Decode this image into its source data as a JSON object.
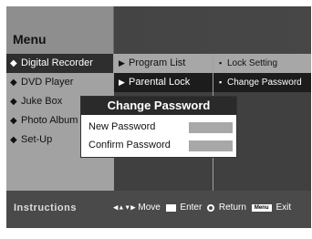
{
  "header": {
    "title": "Menu"
  },
  "main_menu": [
    {
      "label": "Digital Recorder",
      "bullet": "◆",
      "selected": true
    },
    {
      "label": "DVD Player",
      "bullet": "◆"
    },
    {
      "label": "Juke Box",
      "bullet": "◆"
    },
    {
      "label": "Photo Album",
      "bullet": "◆"
    },
    {
      "label": "Set-Up",
      "bullet": "◆"
    }
  ],
  "sub_menu": [
    {
      "label": "Program List",
      "bullet": "▶"
    },
    {
      "label": "Parental Lock",
      "bullet": "▶"
    }
  ],
  "sub_sub_menu": [
    {
      "label": "Lock Setting",
      "bullet": "▪"
    },
    {
      "label": "Change Password",
      "bullet": "▪"
    }
  ],
  "dialog": {
    "title": "Change Password",
    "fields": [
      {
        "label": "New Password",
        "value": ""
      },
      {
        "label": "Confirm Password",
        "value": ""
      }
    ]
  },
  "footer": {
    "instructions_label": "Instructions",
    "hints": {
      "move": "Move",
      "enter": "Enter",
      "return": "Return",
      "exit": "Exit",
      "menu_key": "Menu",
      "move_icon": "◀▲▼▶"
    }
  },
  "colors": {
    "header_left": "#8e8e8e",
    "header_right": "#444444",
    "selection": "#2e2e2e",
    "footer": "#4a4a4a"
  }
}
